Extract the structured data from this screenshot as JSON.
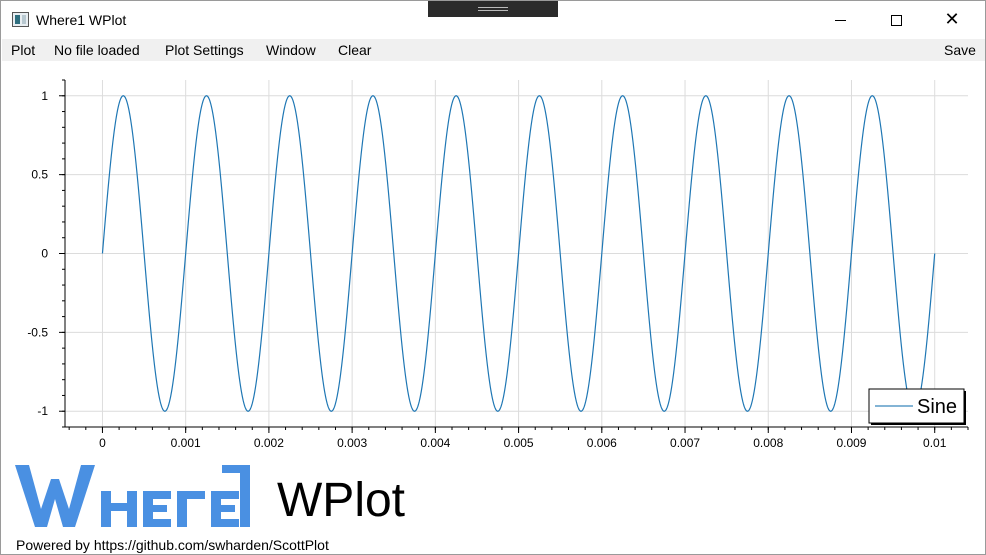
{
  "window": {
    "title": "Where1 WPlot"
  },
  "menu": {
    "items": [
      {
        "id": "plot",
        "label": "Plot"
      },
      {
        "id": "file",
        "label": "No file loaded"
      },
      {
        "id": "settings",
        "label": "Plot Settings"
      },
      {
        "id": "window",
        "label": "Window"
      },
      {
        "id": "clear",
        "label": "Clear"
      }
    ],
    "save_label": "Save"
  },
  "colors": {
    "series": "#1f77b4",
    "grid": "#dcdcdc",
    "logo": "#4a90e2"
  },
  "chart_data": {
    "type": "line",
    "title": "",
    "xlabel": "",
    "ylabel": "",
    "xlim": [
      -0.00045,
      0.0104
    ],
    "ylim": [
      -1.1,
      1.1
    ],
    "xticks": [
      0,
      0.001,
      0.002,
      0.003,
      0.004,
      0.005,
      0.006,
      0.007,
      0.008,
      0.009,
      0.01
    ],
    "xtick_labels": [
      "0",
      "0.001",
      "0.002",
      "0.003",
      "0.004",
      "0.005",
      "0.006",
      "0.007",
      "0.008",
      "0.009",
      "0.01"
    ],
    "yticks": [
      -1,
      -0.5,
      0,
      0.5,
      1
    ],
    "ytick_labels": [
      "-1",
      "-0.5",
      "0",
      "0.5",
      "1"
    ],
    "grid": true,
    "legend_position": "bottom-right",
    "series": [
      {
        "name": "Sine",
        "function": "sin(2*pi*1000*x)",
        "frequency_hz": 1000,
        "amplitude": 1,
        "x_start": 0,
        "x_end": 0.01
      }
    ]
  },
  "branding": {
    "logo_text": "WHERE1",
    "app_name": "WPlot",
    "powered_by": "Powered by https://github.com/swharden/ScottPlot"
  }
}
